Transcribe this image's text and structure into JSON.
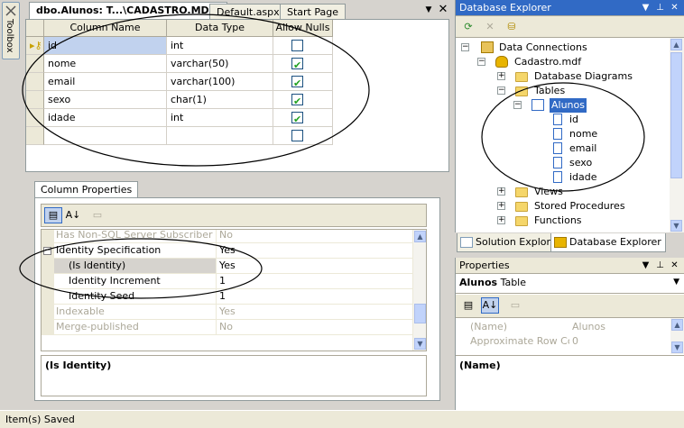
{
  "toolbox": {
    "label": "Toolbox"
  },
  "doc_tabs": [
    {
      "label": "dbo.Alunos: T...\\CADASTRO.MDF)"
    },
    {
      "label": "Default.aspx"
    },
    {
      "label": "Start Page"
    }
  ],
  "designer": {
    "headers": {
      "name": "Column Name",
      "type": "Data Type",
      "nulls": "Allow Nulls"
    },
    "rows": [
      {
        "name": "id",
        "type": "int",
        "allow_nulls": false,
        "key": true
      },
      {
        "name": "nome",
        "type": "varchar(50)",
        "allow_nulls": true
      },
      {
        "name": "email",
        "type": "varchar(100)",
        "allow_nulls": true
      },
      {
        "name": "sexo",
        "type": "char(1)",
        "allow_nulls": true
      },
      {
        "name": "idade",
        "type": "int",
        "allow_nulls": true
      },
      {
        "name": "",
        "type": "",
        "allow_nulls": false
      }
    ]
  },
  "column_properties": {
    "tab_label": "Column Properties",
    "rows": [
      {
        "name": "Has Non-SQL Server Subscriber",
        "value": "No",
        "grey": true
      },
      {
        "name": "Identity Specification",
        "value": "Yes",
        "expander": "−"
      },
      {
        "name": "(Is Identity)",
        "value": "Yes",
        "selected": true
      },
      {
        "name": "Identity Increment",
        "value": "1"
      },
      {
        "name": "Identity Seed",
        "value": "1"
      },
      {
        "name": "Indexable",
        "value": "Yes",
        "grey": true
      },
      {
        "name": "Merge-published",
        "value": "No",
        "grey": true
      }
    ],
    "description": "(Is Identity)"
  },
  "status": {
    "text": "Item(s) Saved"
  },
  "database_explorer": {
    "title": "Database Explorer",
    "tree": [
      {
        "label": "Data Connections",
        "level": 0,
        "expander": "−",
        "icon": "conn"
      },
      {
        "label": "Cadastro.mdf",
        "level": 1,
        "expander": "−",
        "icon": "db"
      },
      {
        "label": "Database Diagrams",
        "level": 2,
        "expander": "+",
        "icon": "folder"
      },
      {
        "label": "Tables",
        "level": 2,
        "expander": "−",
        "icon": "folder"
      },
      {
        "label": "Alunos",
        "level": 3,
        "expander": "−",
        "icon": "table",
        "selected": true
      },
      {
        "label": "id",
        "level": 4,
        "icon": "col"
      },
      {
        "label": "nome",
        "level": 4,
        "icon": "col"
      },
      {
        "label": "email",
        "level": 4,
        "icon": "col"
      },
      {
        "label": "sexo",
        "level": 4,
        "icon": "col"
      },
      {
        "label": "idade",
        "level": 4,
        "icon": "col"
      },
      {
        "label": "Views",
        "level": 2,
        "expander": "+",
        "icon": "folder"
      },
      {
        "label": "Stored Procedures",
        "level": 2,
        "expander": "+",
        "icon": "folder"
      },
      {
        "label": "Functions",
        "level": 2,
        "expander": "+",
        "icon": "folder"
      }
    ]
  },
  "bottom_tabs": [
    {
      "label": "Solution Explorer"
    },
    {
      "label": "Database Explorer",
      "active": true
    }
  ],
  "properties": {
    "title": "Properties",
    "object_name": "Alunos",
    "object_type": "Table",
    "rows": [
      {
        "name": "(Name)",
        "value": "Alunos"
      },
      {
        "name": "Approximate Row Co",
        "value": "0"
      }
    ],
    "description": "(Name)"
  },
  "colors": {
    "accent": "#316ac5",
    "checkmark": "#21a121",
    "panel": "#ece9d8"
  }
}
